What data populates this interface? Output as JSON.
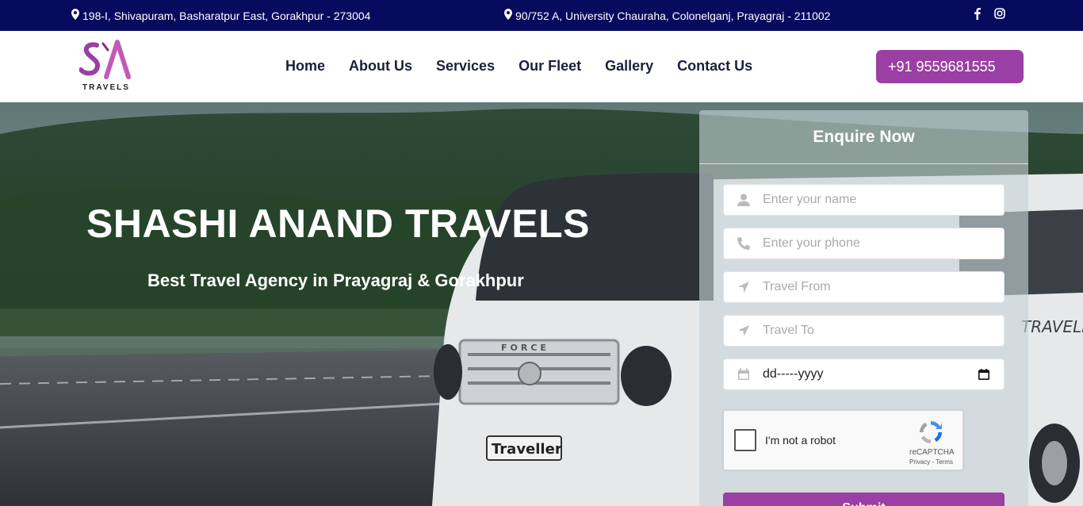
{
  "topbar": {
    "address1": "198-I, Shivapuram, Basharatpur East, Gorakhpur - 273004",
    "address2": "90/752 A, University Chauraha, Colonelganj, Prayagraj - 211002",
    "icons": [
      "map-marker-icon",
      "facebook-icon",
      "instagram-icon"
    ]
  },
  "brand": {
    "logo_text": "TRAVELS"
  },
  "nav": {
    "items": [
      {
        "label": "Home"
      },
      {
        "label": "About Us"
      },
      {
        "label": "Services"
      },
      {
        "label": "Our Fleet"
      },
      {
        "label": "Gallery"
      },
      {
        "label": "Contact Us"
      }
    ],
    "phone": "+91 9559681555"
  },
  "hero": {
    "title": "SHASHI ANAND TRAVELS",
    "subtitle": "Best Travel Agency in Prayagraj & Gorakhpur"
  },
  "form": {
    "title": "Enquire Now",
    "name_placeholder": "Enter your name",
    "phone_placeholder": "Enter your phone",
    "from_placeholder": "Travel From",
    "to_placeholder": "Travel To",
    "date_value": "dd-----yyyy",
    "captcha_label": "I'm not a robot",
    "captcha_brand": "reCAPTCHA",
    "captcha_links": "Privacy - Terms",
    "submit_label": "Submit"
  },
  "colors": {
    "topbar": "#070b5e",
    "accent": "#9a3fa3",
    "nav_text": "#1c1f3a"
  }
}
